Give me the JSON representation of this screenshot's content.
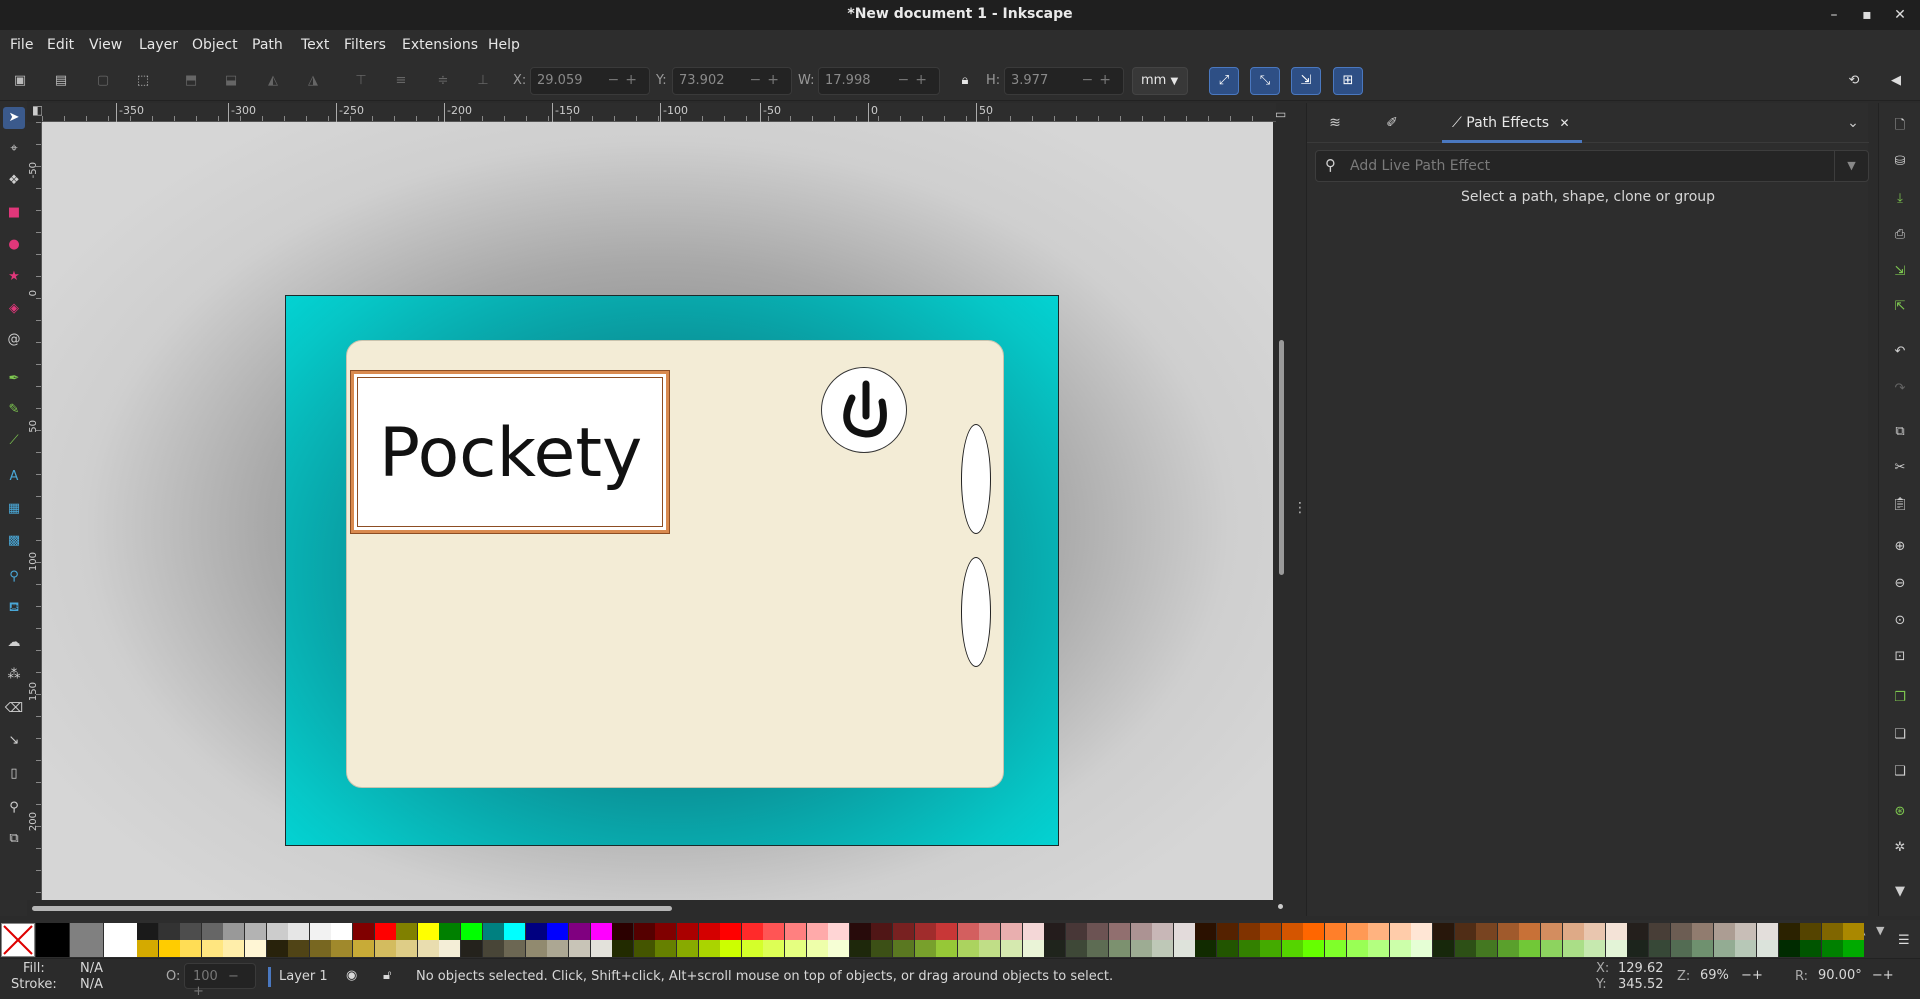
{
  "window": {
    "title": "*New document 1 - Inkscape"
  },
  "menu": [
    "File",
    "Edit",
    "View",
    "Layer",
    "Object",
    "Path",
    "Text",
    "Filters",
    "Extensions",
    "Help"
  ],
  "toolbar": {
    "x_label": "X:",
    "x_value": "29.059",
    "y_label": "Y:",
    "y_value": "73.902",
    "w_label": "W:",
    "w_value": "17.998",
    "h_label": "H:",
    "h_value": "3.977",
    "units": "mm"
  },
  "ruler": {
    "h_ticks": [
      "-350",
      "-300",
      "-250",
      "-200",
      "-150",
      "-100",
      "-50",
      "0",
      "50"
    ],
    "v_ticks": [
      "-50",
      "0",
      "50",
      "100",
      "150",
      "200"
    ]
  },
  "canvas": {
    "label_text": "Pockety",
    "page_color": "#00dede",
    "card_color": "#f3ecd6",
    "label_border_color": "#d98a4f"
  },
  "panel": {
    "active_tab": "Path Effects",
    "search_placeholder": "Add Live Path Effect",
    "hint": "Select a path, shape, clone or group"
  },
  "status": {
    "fill_label": "Fill:",
    "fill_value": "N/A",
    "stroke_label": "Stroke:",
    "stroke_value": "N/A",
    "opacity_label": "O:",
    "opacity_value": "100",
    "layer": "Layer 1",
    "message": "No objects selected. Click, Shift+click, Alt+scroll mouse on top of objects, or drag around objects to select.",
    "cursor_x_label": "X:",
    "cursor_x": "129.62",
    "cursor_y_label": "Y:",
    "cursor_y": "345.52",
    "zoom_label": "Z:",
    "zoom": "69%",
    "rotate_label": "R:",
    "rotate": "90.00°"
  },
  "palette": {
    "top_row": [
      "#000000",
      "#808080",
      "#ffffff",
      "#1a1a1a",
      "#333333",
      "#4d4d4d",
      "#666666",
      "#999999",
      "#b3b3b3",
      "#cccccc",
      "#e6e6e6",
      "#f2f2f2",
      "#ffffff",
      "#800000",
      "#ff0000",
      "#808000",
      "#ffff00",
      "#008000",
      "#00ff00",
      "#008080",
      "#00ffff",
      "#000080",
      "#0000ff",
      "#800080",
      "#ff00ff",
      "#2b0000",
      "#550000",
      "#800000",
      "#aa0000",
      "#d40000",
      "#ff0000",
      "#ff2a2a",
      "#ff5555",
      "#ff8080",
      "#ffaaaa",
      "#ffd5d5",
      "#280b0b",
      "#501616",
      "#782121",
      "#a02c2c",
      "#c83737",
      "#d35f5f",
      "#de8787",
      "#e9afaf",
      "#f4d7d7",
      "#241c1c",
      "#483737",
      "#6c5353",
      "#916f6f",
      "#ac9393",
      "#c8b7b7",
      "#e3dbdb",
      "#2b1100",
      "#552200",
      "#803300",
      "#aa4400",
      "#d45500",
      "#ff6600",
      "#ff7f2a",
      "#ff9955",
      "#ffb380",
      "#ffccaa",
      "#ffe6d5",
      "#28170b",
      "#502d16",
      "#784421",
      "#a05a2c",
      "#c87137",
      "#d38d5f",
      "#deaa87",
      "#e9c6af",
      "#f4e3d7",
      "#241f1c",
      "#483e37",
      "#6c5d53",
      "#917c6f",
      "#ac9d93",
      "#c8beb7",
      "#e3dedb",
      "#2b2200",
      "#554400",
      "#806600",
      "#aa8800",
      "#d4aa00"
    ],
    "bottom_row": [
      "#d4aa00",
      "#ffcc00",
      "#ffdd55",
      "#ffe680",
      "#ffeeaa",
      "#fff6d5",
      "#28220b",
      "#504416",
      "#786721",
      "#a0892c",
      "#c8ab37",
      "#d3bc5f",
      "#decd87",
      "#e9ddaf",
      "#f4eed7",
      "#24221c",
      "#484537",
      "#6c6753",
      "#918a6f",
      "#aca793",
      "#c8c4b7",
      "#e3e2db",
      "#222b00",
      "#445500",
      "#668000",
      "#88aa00",
      "#aad400",
      "#ccff00",
      "#d4ff2a",
      "#ddff55",
      "#e5ff80",
      "#eeffaa",
      "#f6ffd5",
      "#1e280b",
      "#3c5016",
      "#5a7821",
      "#78a02c",
      "#96c837",
      "#abd35f",
      "#c0de87",
      "#d5e9af",
      "#eaf4d7",
      "#1f241c",
      "#3e4837",
      "#5d6c53",
      "#7c916f",
      "#9dac93",
      "#bec8b7",
      "#dee3db",
      "#112b00",
      "#225500",
      "#338000",
      "#44aa00",
      "#55d400",
      "#66ff00",
      "#7fff2a",
      "#99ff55",
      "#b3ff80",
      "#ccffaa",
      "#e5ffd5",
      "#17280b",
      "#2d5016",
      "#447821",
      "#5aa02c",
      "#71c837",
      "#8dd35f",
      "#aade87",
      "#c6e9af",
      "#e3f4d7",
      "#1c241c",
      "#374837",
      "#536c53",
      "#6f916f",
      "#93ac93",
      "#b7c8b7",
      "#dbe3db",
      "#002b00",
      "#005500",
      "#008000",
      "#00aa00"
    ]
  }
}
